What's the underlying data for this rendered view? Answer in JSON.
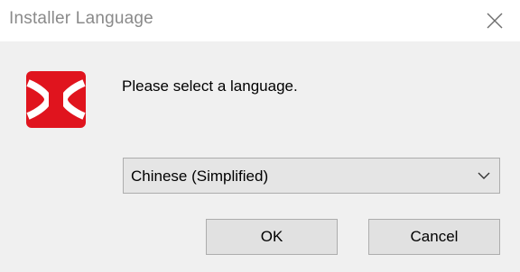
{
  "window": {
    "title": "Installer Language"
  },
  "dialog": {
    "prompt": "Please select a language.",
    "language_select": {
      "selected": "Chinese (Simplified)"
    },
    "ok_label": "OK",
    "cancel_label": "Cancel"
  },
  "icons": {
    "close": "close-icon",
    "logo": "app-logo-icon",
    "dropdown": "chevron-down-icon"
  },
  "colors": {
    "logo_red": "#e0141e",
    "title_text": "#8a8a8a",
    "background": "#f0f0f0"
  }
}
